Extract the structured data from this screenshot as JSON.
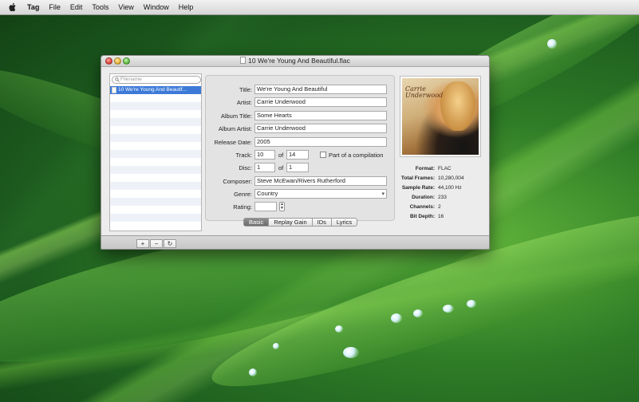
{
  "menubar": {
    "app_name": "Tag",
    "items": [
      "File",
      "Edit",
      "Tools",
      "View",
      "Window",
      "Help"
    ]
  },
  "window": {
    "title": "10 We're Young And Beautiful.flac"
  },
  "sidebar": {
    "search_placeholder": "Filename",
    "files": [
      "10 We're Young And Beautif..."
    ]
  },
  "bottombar": {
    "add_label": "+",
    "remove_label": "−",
    "refresh_label": "↻"
  },
  "form": {
    "title_label": "Title:",
    "title_value": "We're Young And Beautiful",
    "artist_label": "Artist:",
    "artist_value": "Carrie Underwood",
    "album_title_label": "Album Title:",
    "album_title_value": "Some Hearts",
    "album_artist_label": "Album Artist:",
    "album_artist_value": "Carrie Underwood",
    "release_date_label": "Release Date:",
    "release_date_value": "2005",
    "track_label": "Track:",
    "track_value": "10",
    "track_of_label": "of",
    "track_total_value": "14",
    "compilation_label": "Part of a compilation",
    "disc_label": "Disc:",
    "disc_value": "1",
    "disc_of_label": "of",
    "disc_total_value": "1",
    "composer_label": "Composer:",
    "composer_value": "Steve McEwan/Rivers Rutherford",
    "genre_label": "Genre:",
    "genre_value": "Country",
    "rating_label": "Rating:",
    "rating_value": ""
  },
  "tabs": [
    "Basic",
    "Replay Gain",
    "IDs",
    "Lyrics"
  ],
  "artwork": {
    "text_line1": "Carrie",
    "text_line2": "Underwood"
  },
  "info": [
    {
      "label": "Format:",
      "value": "FLAC"
    },
    {
      "label": "Total Frames:",
      "value": "10,280,004"
    },
    {
      "label": "Sample Rate:",
      "value": "44,100 Hz"
    },
    {
      "label": "Duration:",
      "value": "233"
    },
    {
      "label": "Channels:",
      "value": "2"
    },
    {
      "label": "Bit Depth:",
      "value": "16"
    }
  ]
}
